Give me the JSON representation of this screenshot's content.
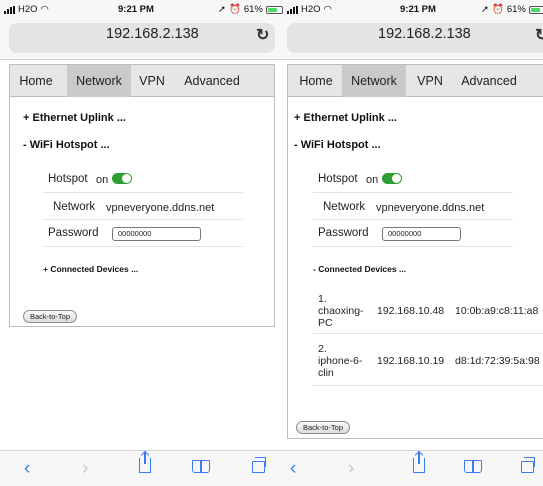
{
  "left": {
    "status": {
      "carrier": "H2O",
      "time": "9:21 PM",
      "battery": "61%",
      "battery_level": 0.61
    },
    "url": "192.168.2.138",
    "tabs": [
      "Home",
      "Network",
      "VPN",
      "Advanced"
    ],
    "active_tab": "Network",
    "ethernet_label": "+ Ethernet Uplink ...",
    "wifi_label": "- WiFi Hotspot ...",
    "hotspot_label": "Hotspot",
    "hotspot_state": "on",
    "network_label": "Network",
    "network_value": "vpneveryone.ddns.net",
    "password_label": "Password",
    "password_value": "00000000",
    "devices_label": "+ Connected Devices ...",
    "back_to_top": "Back-to-Top"
  },
  "right": {
    "status": {
      "carrier": "H2O",
      "time": "9:21 PM",
      "battery": "61%",
      "battery_level": 0.61
    },
    "url": "192.168.2.138",
    "tabs": [
      "Home",
      "Network",
      "VPN",
      "Advanced"
    ],
    "active_tab": "Network",
    "ethernet_label": "+ Ethernet Uplink ...",
    "wifi_label": "- WiFi Hotspot ...",
    "hotspot_label": "Hotspot",
    "hotspot_state": "on",
    "network_label": "Network",
    "network_value": "vpneveryone.ddns.net",
    "password_label": "Password",
    "password_value": "00000000",
    "devices_label": "- Connected Devices ...",
    "devices": [
      {
        "name_lines": [
          "1.",
          "chaoxing-",
          "PC"
        ],
        "ip": "192.168.10.48",
        "mac": "10:0b:a9:c8:11:a8"
      },
      {
        "name_lines": [
          "2.",
          "iphone-6-",
          "clin"
        ],
        "ip": "192.168.10.19",
        "mac": "d8:1d:72:39:5a:98"
      }
    ],
    "back_to_top": "Back-to-Top"
  },
  "colors": {
    "toggle_on": "#2f9e34",
    "safari_blue": "#3b7cf5",
    "active_tab_bg": "#cacaca"
  },
  "icons": [
    "wifi-icon",
    "location-icon",
    "alarm-icon",
    "battery-icon",
    "reload-icon",
    "back-icon",
    "forward-icon",
    "share-icon",
    "bookmarks-icon",
    "tabs-icon"
  ]
}
